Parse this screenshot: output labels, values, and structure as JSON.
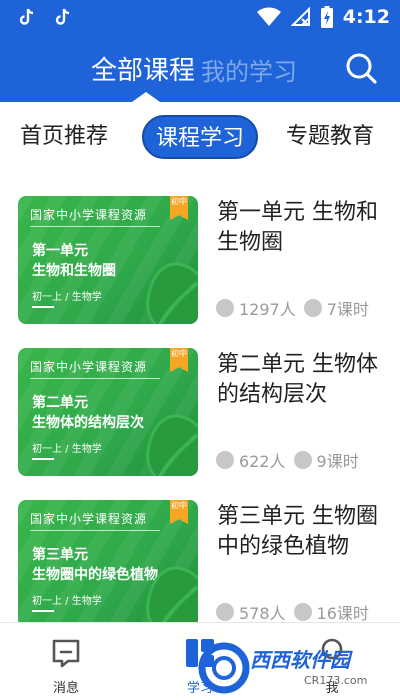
{
  "status_bar": {
    "time": "4:12"
  },
  "header": {
    "tab_active": "全部课程",
    "tab_other": "我的学习"
  },
  "category_tabs": [
    "首页推荐",
    "课程学习",
    "专题教育"
  ],
  "courses": [
    {
      "title": "第一单元 生物和生物圈",
      "thumb_header": "国家中小学课程资源",
      "thumb_badge": "初中",
      "thumb_unit": "第一单元",
      "thumb_name": "生物和生物圈",
      "thumb_sub": "初一上 / 生物学",
      "learners": "1297人",
      "lessons": "7课时"
    },
    {
      "title": "第二单元 生物体的结构层次",
      "thumb_header": "国家中小学课程资源",
      "thumb_badge": "初中",
      "thumb_unit": "第二单元",
      "thumb_name": "生物体的结构层次",
      "thumb_sub": "初一上 / 生物学",
      "learners": "622人",
      "lessons": "9课时"
    },
    {
      "title": "第三单元 生物圈中的绿色植物",
      "thumb_header": "国家中小学课程资源",
      "thumb_badge": "初中",
      "thumb_unit": "第三单元",
      "thumb_name": "生物圈中的绿色植物",
      "thumb_sub": "初一上 / 生物学",
      "learners": "578人",
      "lessons": "16课时"
    }
  ],
  "bottom_nav": [
    "消息",
    "学习",
    "我"
  ],
  "watermark": {
    "brand": "西西软件园",
    "site": "CR173.com"
  },
  "colors": {
    "primary": "#1e63d8",
    "thumb_green": "#39b54a",
    "badge_orange": "#f5a623"
  }
}
